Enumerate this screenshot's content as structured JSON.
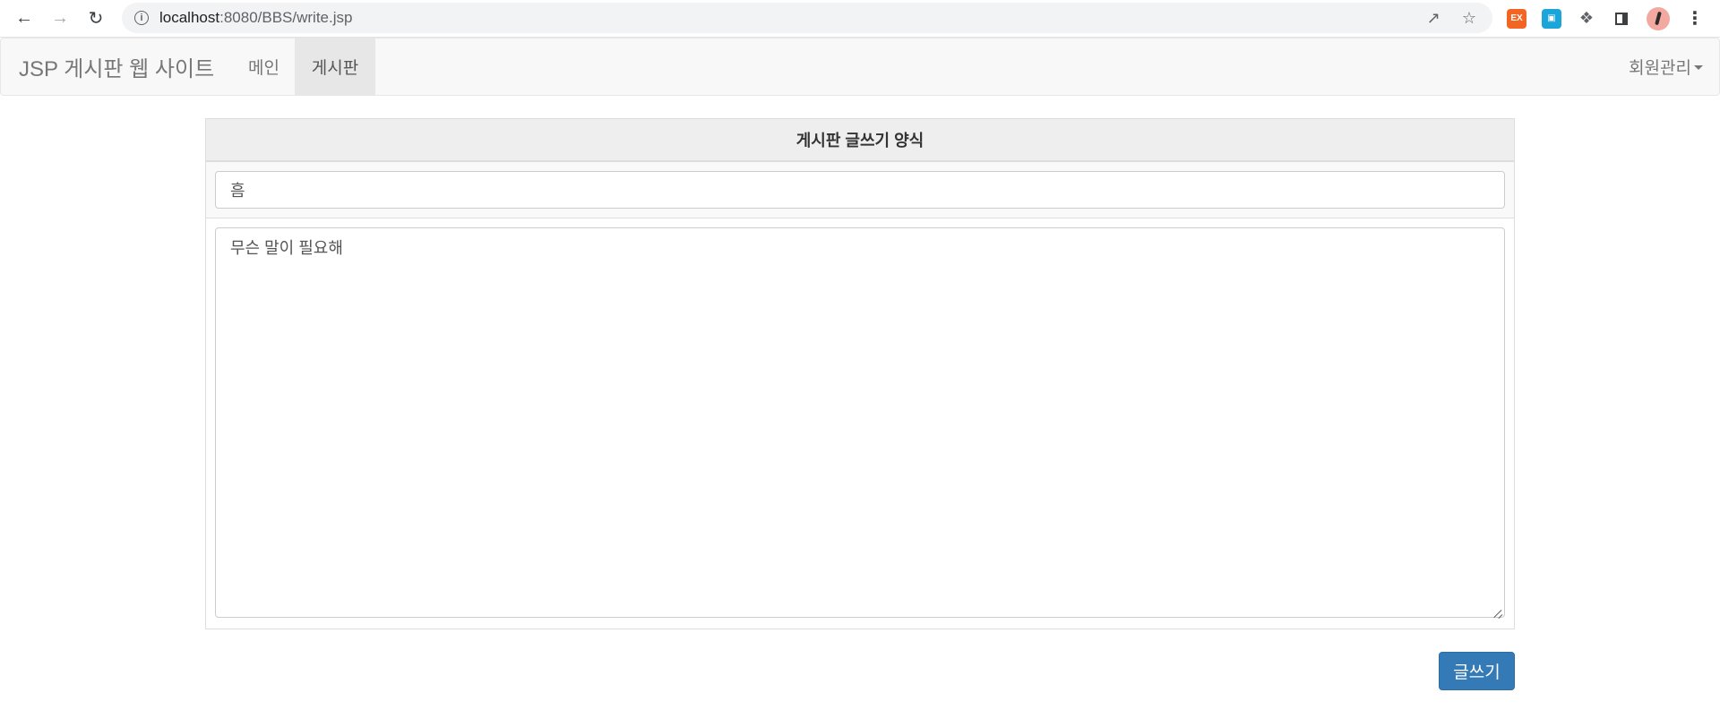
{
  "browser": {
    "url_host": "localhost",
    "url_path": ":8080/BBS/write.jsp",
    "extensions": [
      {
        "name": "ex-extension-icon",
        "label": "EX"
      }
    ]
  },
  "navbar": {
    "brand": "JSP 게시판 웹 사이트",
    "items": [
      {
        "label": "메인",
        "active": false
      },
      {
        "label": "게시판",
        "active": true
      }
    ],
    "member_menu": "회원관리"
  },
  "form": {
    "heading": "게시판 글쓰기 양식",
    "title_value": "흠",
    "content_value": "무슨 말이 필요해",
    "submit_label": "글쓰기"
  },
  "colors": {
    "primary": "#337ab7",
    "navbar_bg": "#f8f8f8",
    "active_nav_bg": "#e7e7e7",
    "table_head_bg": "#eeeeee"
  }
}
